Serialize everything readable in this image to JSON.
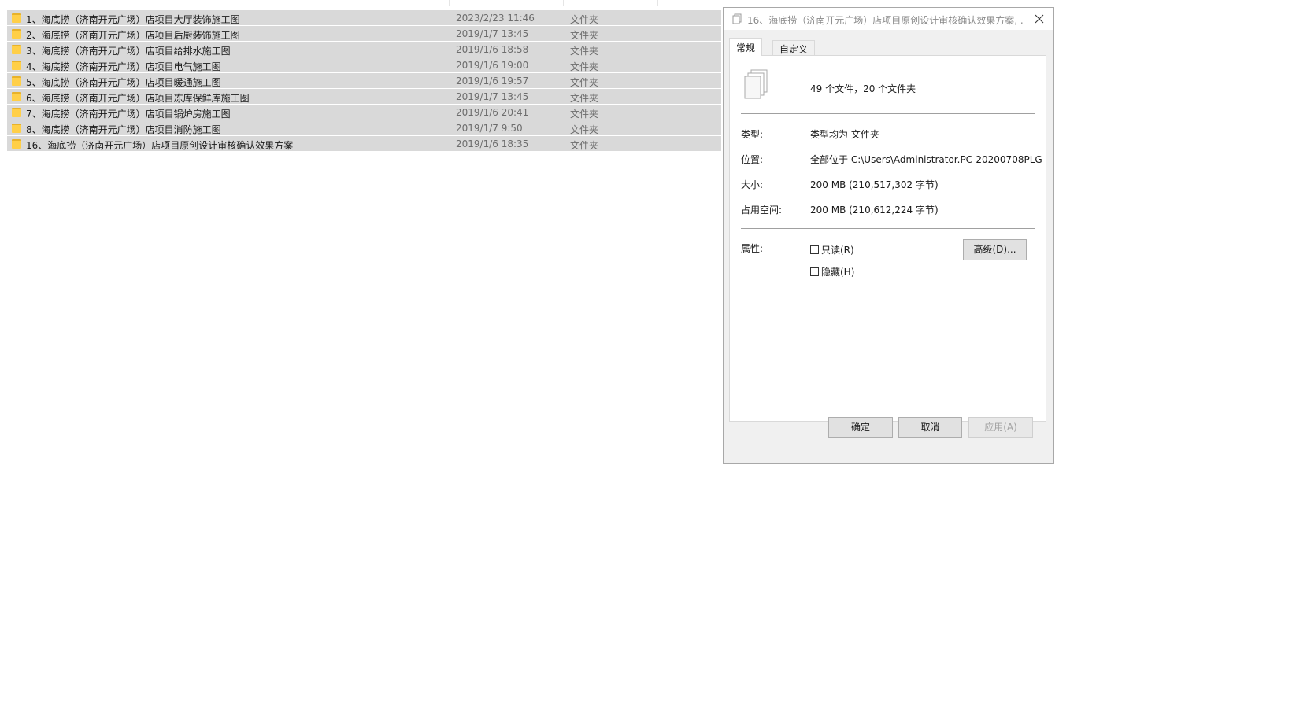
{
  "files": [
    {
      "name": "1、海底捞（济南开元广场）店项目大厅装饰施工图",
      "date": "2023/2/23 11:46",
      "type": "文件夹"
    },
    {
      "name": "2、海底捞（济南开元广场）店项目后厨装饰施工图",
      "date": "2019/1/7 13:45",
      "type": "文件夹"
    },
    {
      "name": "3、海底捞（济南开元广场）店项目给排水施工图",
      "date": "2019/1/6 18:58",
      "type": "文件夹"
    },
    {
      "name": "4、海底捞（济南开元广场）店项目电气施工图",
      "date": "2019/1/6 19:00",
      "type": "文件夹"
    },
    {
      "name": "5、海底捞（济南开元广场）店项目暖通施工图",
      "date": "2019/1/6 19:57",
      "type": "文件夹"
    },
    {
      "name": "6、海底捞（济南开元广场）店项目冻库保鲜库施工图",
      "date": "2019/1/7 13:45",
      "type": "文件夹"
    },
    {
      "name": "7、海底捞（济南开元广场）店项目锅炉房施工图",
      "date": "2019/1/6 20:41",
      "type": "文件夹"
    },
    {
      "name": "8、海底捞（济南开元广场）店项目消防施工图",
      "date": "2019/1/7 9:50",
      "type": "文件夹"
    },
    {
      "name": "16、海底捞（济南开元广场）店项目原创设计审核确认效果方案",
      "date": "2019/1/6 18:35",
      "type": "文件夹"
    }
  ],
  "dialog": {
    "title": "16、海底捞（济南开元广场）店项目原创设计审核确认效果方案, ...",
    "tabs": {
      "general": "常规",
      "custom": "自定义"
    },
    "summary": "49 个文件，20 个文件夹",
    "props": {
      "type_label": "类型:",
      "type_value": "类型均为 文件夹",
      "location_label": "位置:",
      "location_value": "全部位于 C:\\Users\\Administrator.PC-20200708PLG",
      "size_label": "大小:",
      "size_value": "200 MB (210,517,302 字节)",
      "disk_label": "占用空间:",
      "disk_value": "200 MB (210,612,224 字节)",
      "attr_label": "属性:"
    },
    "readonly_label": "只读(R)",
    "hidden_label": "隐藏(H)",
    "advanced_label": "高级(D)...",
    "ok_label": "确定",
    "cancel_label": "取消",
    "apply_label": "应用(A)"
  }
}
